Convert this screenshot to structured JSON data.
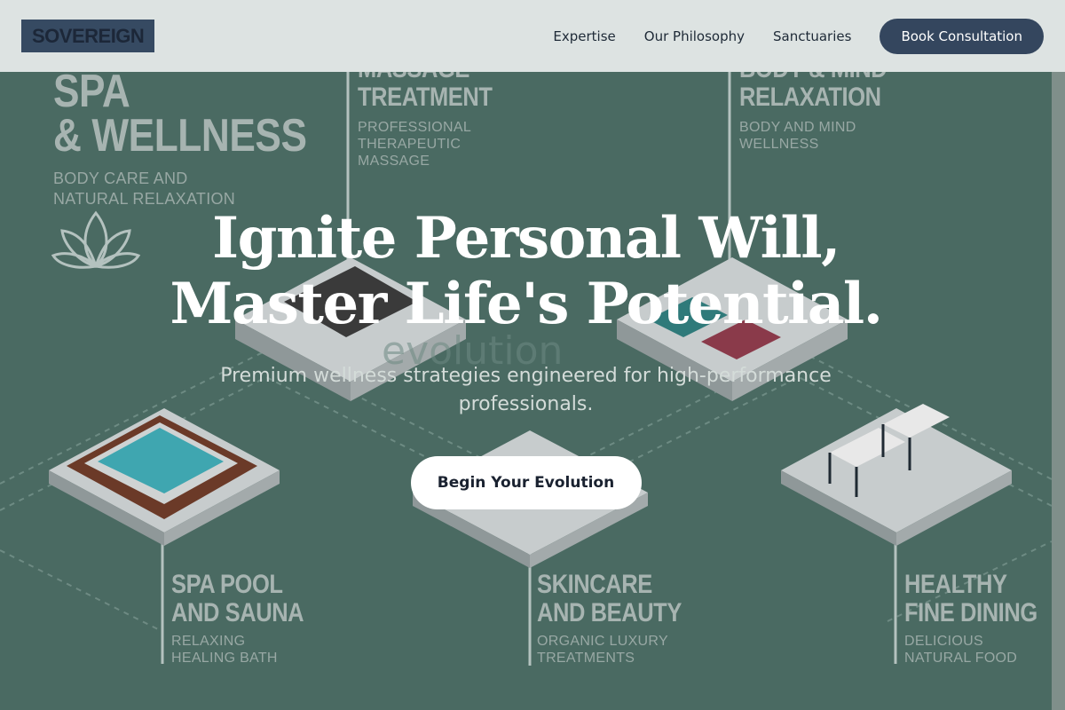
{
  "brand": {
    "logo": "SOVEREIGN"
  },
  "nav": {
    "links": [
      "Expertise",
      "Our Philosophy",
      "Sanctuaries"
    ],
    "cta": "Book Consultation"
  },
  "hero": {
    "headline_line1": "Ignite Personal Will,",
    "headline_line2": "Master Life's Potential.",
    "subheadline": "Premium wellness strategies engineered for high-performance professionals.",
    "button": "Begin Your Evolution"
  },
  "illustration": {
    "spa": {
      "title1": "SPA",
      "title2": "& WELLNESS",
      "sub1": "BODY CARE AND",
      "sub2": "NATURAL RELAXATION"
    },
    "massage": {
      "title1": "MASSAGE",
      "title2": "TREATMENT",
      "sub1": "PROFESSIONAL",
      "sub2": "THERAPEUTIC",
      "sub3": "MASSAGE"
    },
    "mind": {
      "title1": "BODY & MIND",
      "title2": "RELAXATION",
      "sub1": "BODY AND MIND",
      "sub2": "WELLNESS"
    },
    "pool": {
      "title1": "SPA POOL",
      "title2": "AND SAUNA",
      "sub1": "RELAXING",
      "sub2": "HEALING BATH"
    },
    "skincare": {
      "title1": "SKINCARE",
      "title2": "AND BEAUTY",
      "sub1": "ORGANIC LUXURY",
      "sub2": "TREATMENTS"
    },
    "dining": {
      "title1": "HEALTHY",
      "title2": "FINE DINING",
      "sub1": "DELICIOUS",
      "sub2": "NATURAL FOOD"
    },
    "watermark": "evolution"
  },
  "colors": {
    "overlay": "#4a6a62",
    "header_bg": "#dde3e2",
    "cta_bg": "#34465e",
    "logo_bg": "#364a62"
  }
}
